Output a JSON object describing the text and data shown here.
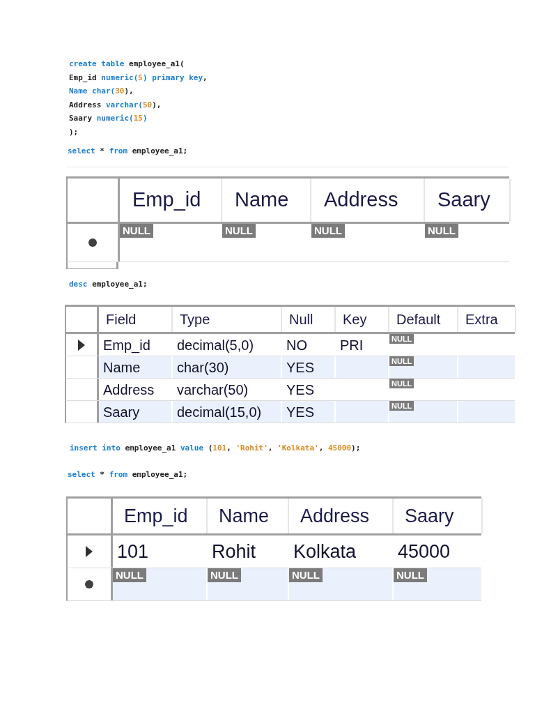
{
  "blocks": [
    {
      "kind": "code",
      "lines": [
        [
          {
            "text": "create table ",
            "kind": "keyword"
          },
          {
            "text": "employee_a1(",
            "kind": "plain"
          }
        ],
        [
          {
            "text": "Emp_id ",
            "kind": "plain"
          },
          {
            "text": "numeric(",
            "kind": "keyword"
          },
          {
            "text": "5",
            "kind": "number"
          },
          {
            "text": ") primary key",
            "kind": "keyword"
          },
          {
            "text": ",",
            "kind": "plain"
          }
        ],
        [
          {
            "text": "Name char(",
            "kind": "keyword"
          },
          {
            "text": "30",
            "kind": "number"
          },
          {
            "text": "),",
            "kind": "plain"
          }
        ],
        [
          {
            "text": "Address ",
            "kind": "plain"
          },
          {
            "text": "varchar(",
            "kind": "keyword"
          },
          {
            "text": "50",
            "kind": "number"
          },
          {
            "text": "),",
            "kind": "plain"
          }
        ],
        [
          {
            "text": "Saary ",
            "kind": "plain"
          },
          {
            "text": "numeric(",
            "kind": "keyword"
          },
          {
            "text": "15",
            "kind": "number"
          },
          {
            "text": ")",
            "kind": "keyword"
          }
        ],
        [
          {
            "text": ");",
            "kind": "plain"
          }
        ]
      ]
    },
    {
      "kind": "code",
      "lines": [
        [
          {
            "text": "select",
            "kind": "keyword"
          },
          {
            "text": " * ",
            "kind": "plain"
          },
          {
            "text": "from ",
            "kind": "keyword"
          },
          {
            "text": "employee_a1;",
            "kind": "plain"
          }
        ]
      ]
    },
    {
      "kind": "grid",
      "columns": [
        "Emp_id",
        "Name",
        "Address",
        "Saary"
      ],
      "rows": [
        {
          "current": false,
          "new_row": true,
          "cells": [
            {
              "value": "NULL",
              "kind": "null"
            },
            {
              "value": "NULL",
              "kind": "null"
            },
            {
              "value": "NULL",
              "kind": "null"
            },
            {
              "value": "NULL",
              "kind": "null"
            }
          ]
        }
      ]
    },
    {
      "kind": "code",
      "lines": [
        [
          {
            "text": "desc ",
            "kind": "keyword"
          },
          {
            "text": "employee_a1;",
            "kind": "plain"
          }
        ]
      ]
    },
    {
      "kind": "grid",
      "columns": [
        "Field",
        "Type",
        "Null",
        "Key",
        "Default",
        "Extra"
      ],
      "rows": [
        {
          "current": true,
          "new_row": false,
          "cells": [
            {
              "value": "Emp_id",
              "kind": "text"
            },
            {
              "value": "decimal(5,0)",
              "kind": "text"
            },
            {
              "value": "NO",
              "kind": "text"
            },
            {
              "value": "PRI",
              "kind": "text"
            },
            {
              "value": "NULL",
              "kind": "null"
            },
            {
              "kind": "text"
            }
          ]
        },
        {
          "current": false,
          "new_row": false,
          "cells": [
            {
              "value": "Name",
              "kind": "text"
            },
            {
              "value": "char(30)",
              "kind": "text"
            },
            {
              "value": "YES",
              "kind": "text"
            },
            {
              "kind": "text"
            },
            {
              "value": "NULL",
              "kind": "null"
            },
            {
              "kind": "text"
            }
          ]
        },
        {
          "current": false,
          "new_row": false,
          "cells": [
            {
              "value": "Address",
              "kind": "text"
            },
            {
              "value": "varchar(50)",
              "kind": "text"
            },
            {
              "value": "YES",
              "kind": "text"
            },
            {
              "kind": "text"
            },
            {
              "value": "NULL",
              "kind": "null"
            },
            {
              "kind": "text"
            }
          ]
        },
        {
          "current": false,
          "new_row": false,
          "cells": [
            {
              "value": "Saary",
              "kind": "text"
            },
            {
              "value": "decimal(15,0)",
              "kind": "text"
            },
            {
              "value": "YES",
              "kind": "text"
            },
            {
              "kind": "text"
            },
            {
              "value": "NULL",
              "kind": "null"
            },
            {
              "kind": "text"
            }
          ]
        }
      ]
    },
    {
      "kind": "code",
      "lines": [
        [
          {
            "text": "insert into ",
            "kind": "keyword"
          },
          {
            "text": "employee_a1 ",
            "kind": "plain"
          },
          {
            "text": "value ",
            "kind": "keyword"
          },
          {
            "text": "(",
            "kind": "plain"
          },
          {
            "text": "101",
            "kind": "number"
          },
          {
            "text": ", ",
            "kind": "plain"
          },
          {
            "text": "'Rohit'",
            "kind": "string"
          },
          {
            "text": ", ",
            "kind": "plain"
          },
          {
            "text": "'Kolkata'",
            "kind": "string"
          },
          {
            "text": ", ",
            "kind": "plain"
          },
          {
            "text": "45000",
            "kind": "number"
          },
          {
            "text": ");",
            "kind": "plain"
          }
        ]
      ]
    },
    {
      "kind": "code",
      "lines": [
        [
          {
            "text": "select",
            "kind": "keyword"
          },
          {
            "text": " * ",
            "kind": "plain"
          },
          {
            "text": "from ",
            "kind": "keyword"
          },
          {
            "text": "employee_a1;",
            "kind": "plain"
          }
        ]
      ]
    },
    {
      "kind": "grid",
      "columns": [
        "Emp_id",
        "Name",
        "Address",
        "Saary"
      ],
      "rows": [
        {
          "current": true,
          "new_row": false,
          "cells": [
            {
              "value": "101",
              "kind": "text"
            },
            {
              "value": "Rohit",
              "kind": "text"
            },
            {
              "value": "Kolkata",
              "kind": "text"
            },
            {
              "value": "45000",
              "kind": "text"
            }
          ]
        },
        {
          "current": false,
          "new_row": true,
          "cells": [
            {
              "value": "NULL",
              "kind": "null"
            },
            {
              "value": "NULL",
              "kind": "null"
            },
            {
              "value": "NULL",
              "kind": "null"
            },
            {
              "value": "NULL",
              "kind": "null"
            }
          ]
        }
      ]
    }
  ]
}
